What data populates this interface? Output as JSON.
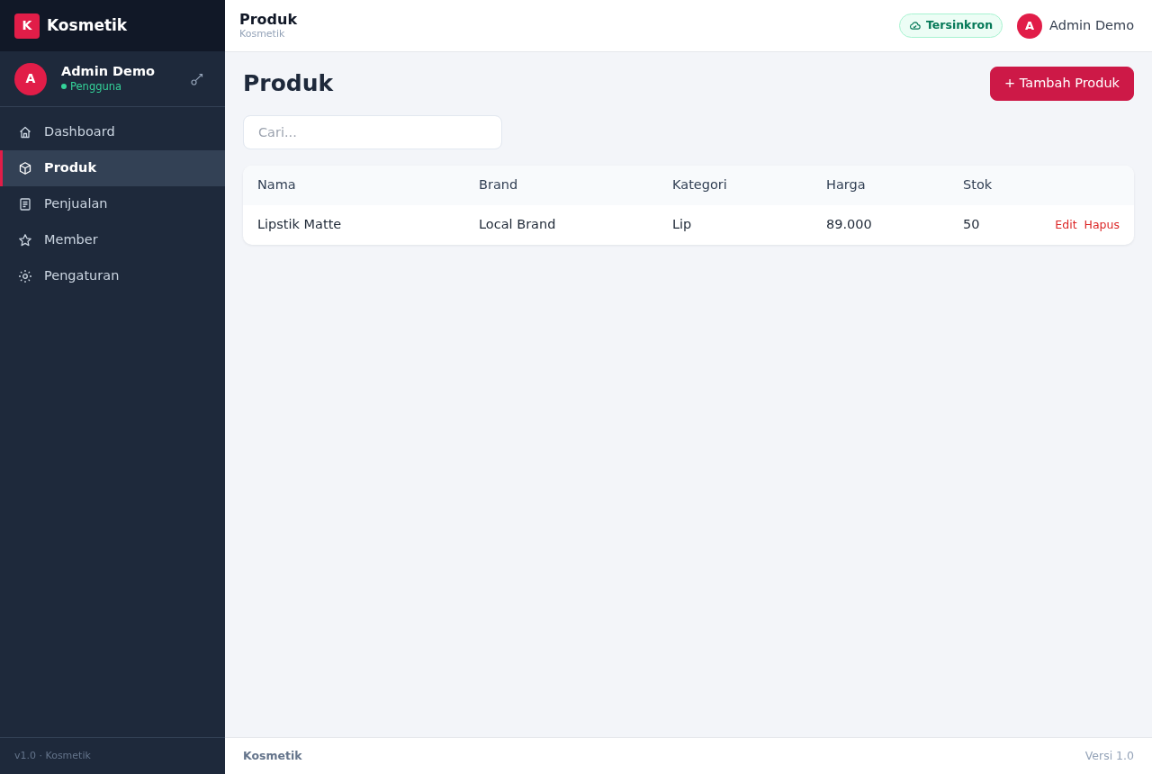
{
  "sidebar": {
    "brand": {
      "logo_letter": "K",
      "name": "Kosmetik"
    },
    "user": {
      "avatar_letter": "A",
      "name": "Admin Demo",
      "role": "Pengguna"
    },
    "nav_items": [
      {
        "label": "Dashboard",
        "selected": false
      },
      {
        "label": "Produk",
        "selected": true
      },
      {
        "label": "Penjualan",
        "selected": false
      },
      {
        "label": "Member",
        "selected": false
      },
      {
        "label": "Pengaturan",
        "selected": false
      }
    ],
    "footer": "v1.0 · Kosmetik"
  },
  "topbar": {
    "title": "Produk",
    "subtitle": "Kosmetik",
    "sync_badge": "Tersinkron",
    "user": {
      "avatar_letter": "A",
      "name": "Admin Demo"
    }
  },
  "page": {
    "title": "Produk",
    "add_button": "+ Tambah Produk",
    "search": {
      "placeholder": "Cari..."
    },
    "table": {
      "columns": [
        "Nama",
        "Brand",
        "Kategori",
        "Harga",
        "Stok"
      ],
      "rows": [
        {
          "cells": [
            "Lipstik Matte",
            "Local Brand",
            "Lip",
            "89.000",
            "50"
          ],
          "actions": [
            "Edit",
            "Hapus"
          ]
        }
      ]
    }
  },
  "footer": {
    "brand": "Kosmetik",
    "version": "Versi 1.0"
  }
}
